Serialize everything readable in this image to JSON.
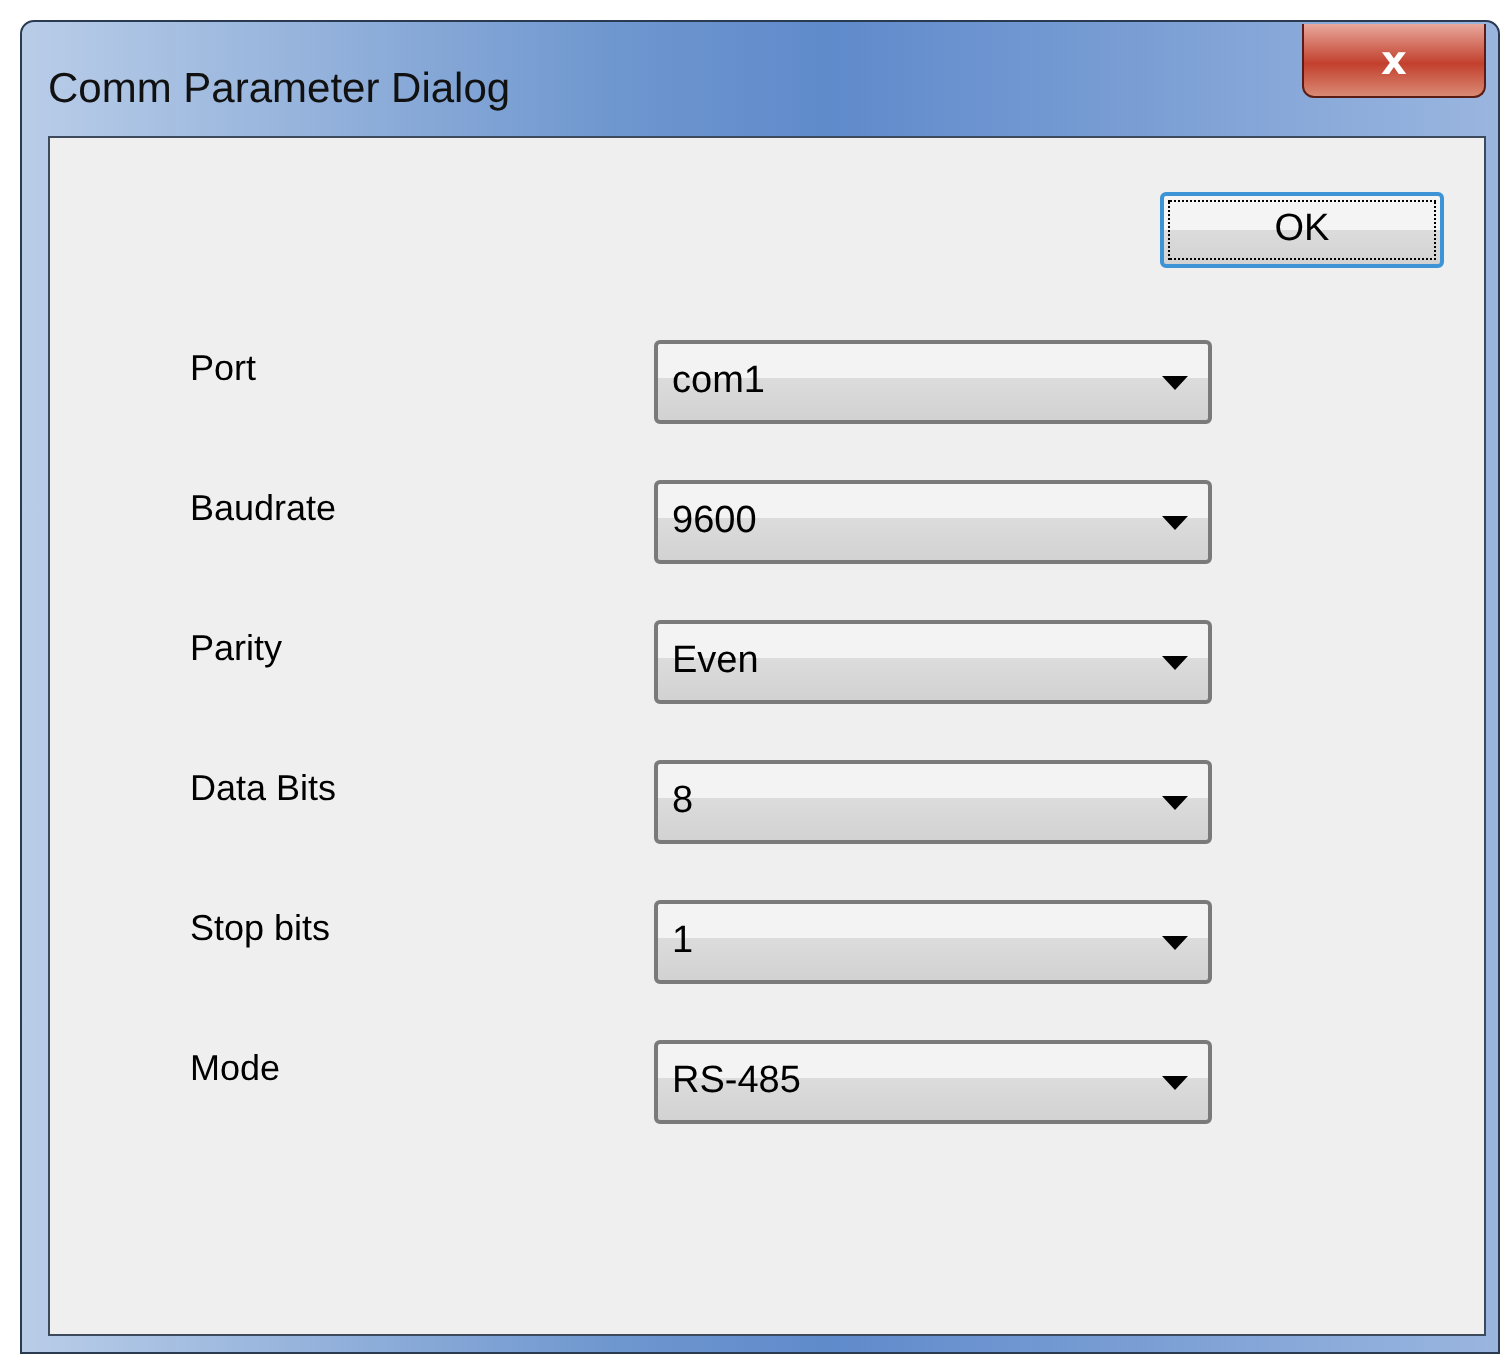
{
  "window": {
    "title": "Comm Parameter Dialog",
    "close_button": "x"
  },
  "ok_button": "OK",
  "fields": [
    {
      "label": "Port",
      "value": "com1"
    },
    {
      "label": "Baudrate",
      "value": "9600"
    },
    {
      "label": "Parity",
      "value": "Even"
    },
    {
      "label": "Data Bits",
      "value": "8"
    },
    {
      "label": "Stop bits",
      "value": "1"
    },
    {
      "label": "Mode",
      "value": "RS-485"
    }
  ]
}
